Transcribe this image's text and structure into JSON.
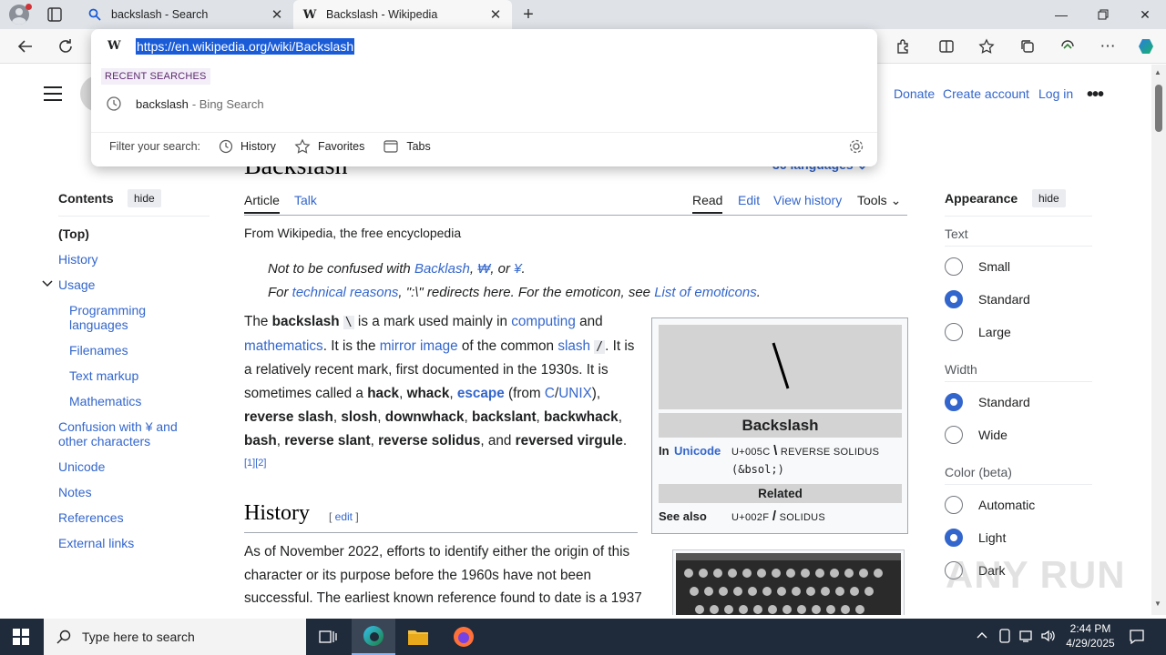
{
  "browser": {
    "tabs": [
      {
        "title": "backslash - Search",
        "favicon": "search-icon"
      },
      {
        "title": "Backslash - Wikipedia",
        "favicon": "W"
      }
    ],
    "url": "https://en.wikipedia.org/wiki/Backslash",
    "omnibox": {
      "favicon": "W",
      "recent_label": "RECENT SEARCHES",
      "recent": [
        {
          "query": "backslash",
          "source": "- Bing Search"
        }
      ],
      "filter_label": "Filter your search:",
      "filters": [
        "History",
        "Favorites",
        "Tabs"
      ]
    }
  },
  "wiki": {
    "top_links": [
      "Donate",
      "Create account",
      "Log in"
    ],
    "title": "Backslash",
    "languages": "36 languages",
    "toc": {
      "title": "Contents",
      "hide": "hide",
      "items": [
        "(Top)",
        "History",
        "Usage",
        "Programming languages",
        "Filenames",
        "Text markup",
        "Mathematics",
        "Confusion with ¥ and other characters",
        "Unicode",
        "Notes",
        "References",
        "External links"
      ]
    },
    "tabs": {
      "article": "Article",
      "talk": "Talk",
      "read": "Read",
      "edit": "Edit",
      "history": "View history",
      "tools": "Tools"
    },
    "from": "From Wikipedia, the free encyclopedia",
    "hatnote1": {
      "pre": "Not to be confused with ",
      "l1": "Backlash",
      "sep1": ", ",
      "l2": "₩",
      "sep2": ", or ",
      "l3": "¥",
      "end": "."
    },
    "hatnote2": {
      "pre": "For ",
      "l1": "technical reasons",
      "mid": ", \":\\\" redirects here. For the emoticon, see ",
      "l2": "List of emoticons",
      "end": "."
    },
    "intro": {
      "t1": "The ",
      "b1": "backslash",
      "bs": "\\",
      "t2": " is a mark used mainly in ",
      "a1": "computing",
      "t3": " and ",
      "a2": "mathematics",
      "t4": ". It is the ",
      "a3": "mirror image",
      "t5": " of the common ",
      "a4": "slash",
      "fs": "/",
      "t6": ". It is a relatively recent mark, first documented in the 1930s. It is sometimes called a ",
      "b2": "hack",
      "c1": ", ",
      "b3": "whack",
      "c2": ", ",
      "a5": "escape",
      "t7": " (from ",
      "a6": "C",
      "slash": "/",
      "a7": "UNIX",
      "t8": "), ",
      "b4": "reverse slash",
      "c3": ", ",
      "b5": "slosh",
      "c4": ", ",
      "b6": "downwhack",
      "c5": ", ",
      "b7": "backslant",
      "c6": ", ",
      "b8": "backwhack",
      "c7": ", ",
      "b9": "bash",
      "c8": ", ",
      "b10": "reverse slant",
      "c9": ", ",
      "b11": "reverse solidus",
      "c10": ", and ",
      "b12": "reversed virgule",
      "t9": ".",
      "ref1": "[1]",
      "ref2": "[2]"
    },
    "history_heading": "History",
    "edit_link": "edit",
    "history_text": "As of November 2022, efforts to identify either the origin of this character or its purpose before the 1960s have not been successful. The earliest known reference found to date is a 1937",
    "infobox": {
      "glyph": "\\",
      "title": "Backslash",
      "in_label": "In",
      "unicode_link": "Unicode",
      "code": "U+005C",
      "name": "REVERSE SOLIDUS",
      "entity": "(&bsol;)",
      "related": "Related",
      "see_also": "See also",
      "see_code": "U+002F",
      "see_glyph": "/",
      "see_name": "SOLIDUS"
    },
    "appearance": {
      "title": "Appearance",
      "hide": "hide",
      "text_label": "Text",
      "text_options": [
        "Small",
        "Standard",
        "Large"
      ],
      "text_selected": "Standard",
      "width_label": "Width",
      "width_options": [
        "Standard",
        "Wide"
      ],
      "width_selected": "Standard",
      "color_label": "Color (beta)",
      "color_options": [
        "Automatic",
        "Light",
        "Dark"
      ],
      "color_selected": "Light"
    }
  },
  "watermark": "ANY RUN",
  "taskbar": {
    "search_placeholder": "Type here to search",
    "time": "2:44 PM",
    "date": "4/29/2025"
  }
}
